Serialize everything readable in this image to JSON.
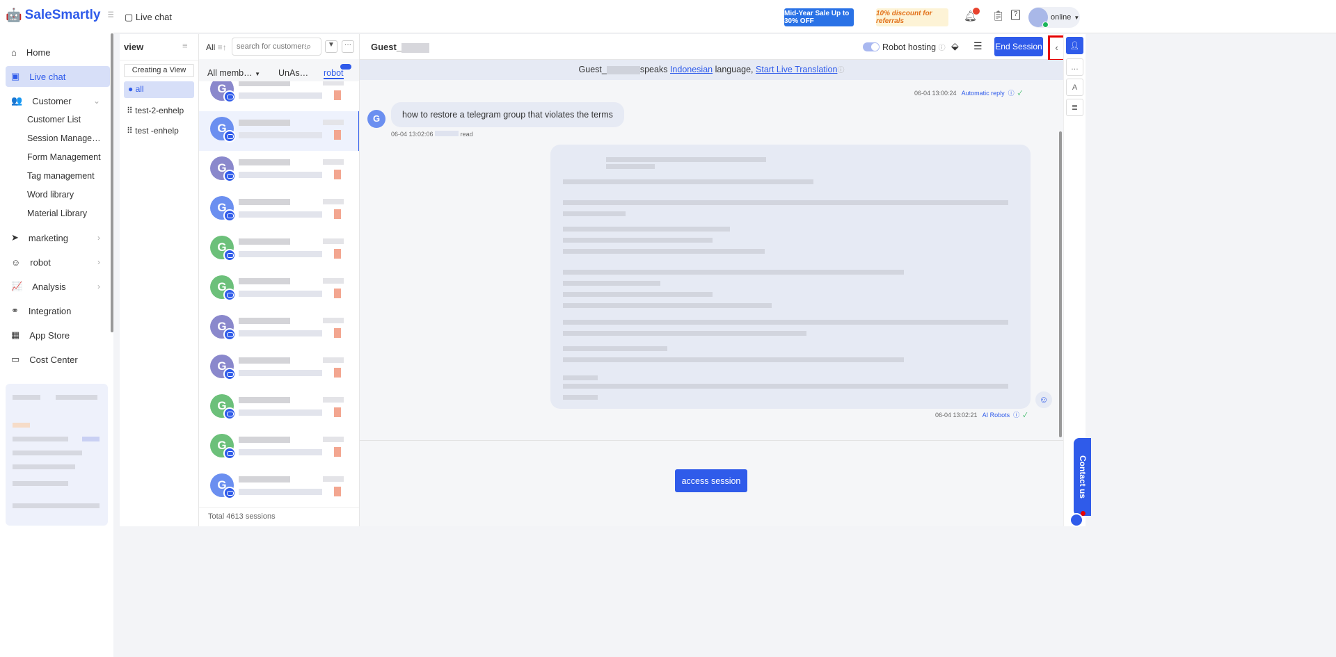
{
  "app": {
    "name": "SaleSmartly",
    "page_title": "Live chat"
  },
  "sidebar": {
    "items": [
      {
        "label": "Home"
      },
      {
        "label": "Live chat"
      },
      {
        "label": "Customer"
      },
      {
        "label": "marketing"
      },
      {
        "label": "robot"
      },
      {
        "label": "Analysis"
      },
      {
        "label": "Integration"
      },
      {
        "label": "App Store"
      },
      {
        "label": "Cost Center"
      }
    ],
    "customer_sub": [
      "Customer List",
      "Session Manage…",
      "Form Management",
      "Tag management",
      "Word library",
      "Material Library"
    ]
  },
  "header": {
    "promo1": "Mid-Year Sale Up to 30% OFF",
    "promo2": "10% discount for referrals",
    "status": "online"
  },
  "views": {
    "title": "view",
    "create": "Creating a View",
    "items": [
      "all",
      "test-2-enhelp",
      "test -enhelp"
    ]
  },
  "sessions": {
    "filter_all": "All",
    "search_placeholder": "search for customers",
    "tabs": [
      "All memb…",
      "UnAs…",
      "robot"
    ],
    "footer": "Total 4613 sessions",
    "avatar_letter": "G",
    "avatar_colors": [
      "#8a88cc",
      "#6b8ff0",
      "#8a88cc",
      "#6b8ff0",
      "#6cc07a",
      "#6cc07a",
      "#8a88cc",
      "#8a88cc",
      "#6cc07a",
      "#6cc07a",
      "#6b8ff0"
    ]
  },
  "chat": {
    "guest": "Guest_",
    "robot_hosting": "Robot hosting",
    "end_session": "End Session",
    "banner": {
      "prefix": "Guest_",
      "speaks": "speaks",
      "language": "Indonesian",
      "mid": "language,",
      "link": "Start Live Translation"
    },
    "msg0": {
      "time": "06-04 13:00:24",
      "tag": "Automatic reply"
    },
    "msg1": {
      "text": "how to restore a telegram group that violates the terms",
      "time": "06-04 13:02:06",
      "status": "read"
    },
    "msg2": {
      "time": "06-04 13:02:21",
      "tag": "AI Robots"
    },
    "access": "access session"
  },
  "contact": "Contact us",
  "colors": {
    "accent": "#2f5bea",
    "highlight": "#e60000"
  }
}
